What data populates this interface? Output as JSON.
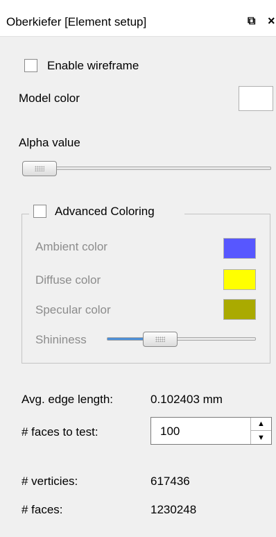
{
  "window": {
    "title": "Oberkiefer [Element setup]",
    "float_icon": "⧉",
    "close_icon": "×"
  },
  "wireframe": {
    "label": "Enable wireframe",
    "checked": false
  },
  "model_color": {
    "label": "Model color",
    "value": "#ffffff"
  },
  "alpha": {
    "label": "Alpha value"
  },
  "advanced": {
    "label": "Advanced Coloring",
    "checked": false,
    "ambient": {
      "label": "Ambient color",
      "color": "#5757ff"
    },
    "diffuse": {
      "label": "Diffuse color",
      "color": "#ffff00"
    },
    "specular": {
      "label": "Specular color",
      "color": "#aaaa00"
    },
    "shininess": {
      "label": "Shininess"
    }
  },
  "stats": {
    "avg_edge_label": "Avg. edge length:",
    "avg_edge_value": "0.102403 mm",
    "faces_to_test_label": "# faces to test:",
    "faces_to_test_value": "100",
    "vertices_label": "# verticies:",
    "vertices_value": "617436",
    "faces_label": "# faces:",
    "faces_value": "1230248"
  }
}
